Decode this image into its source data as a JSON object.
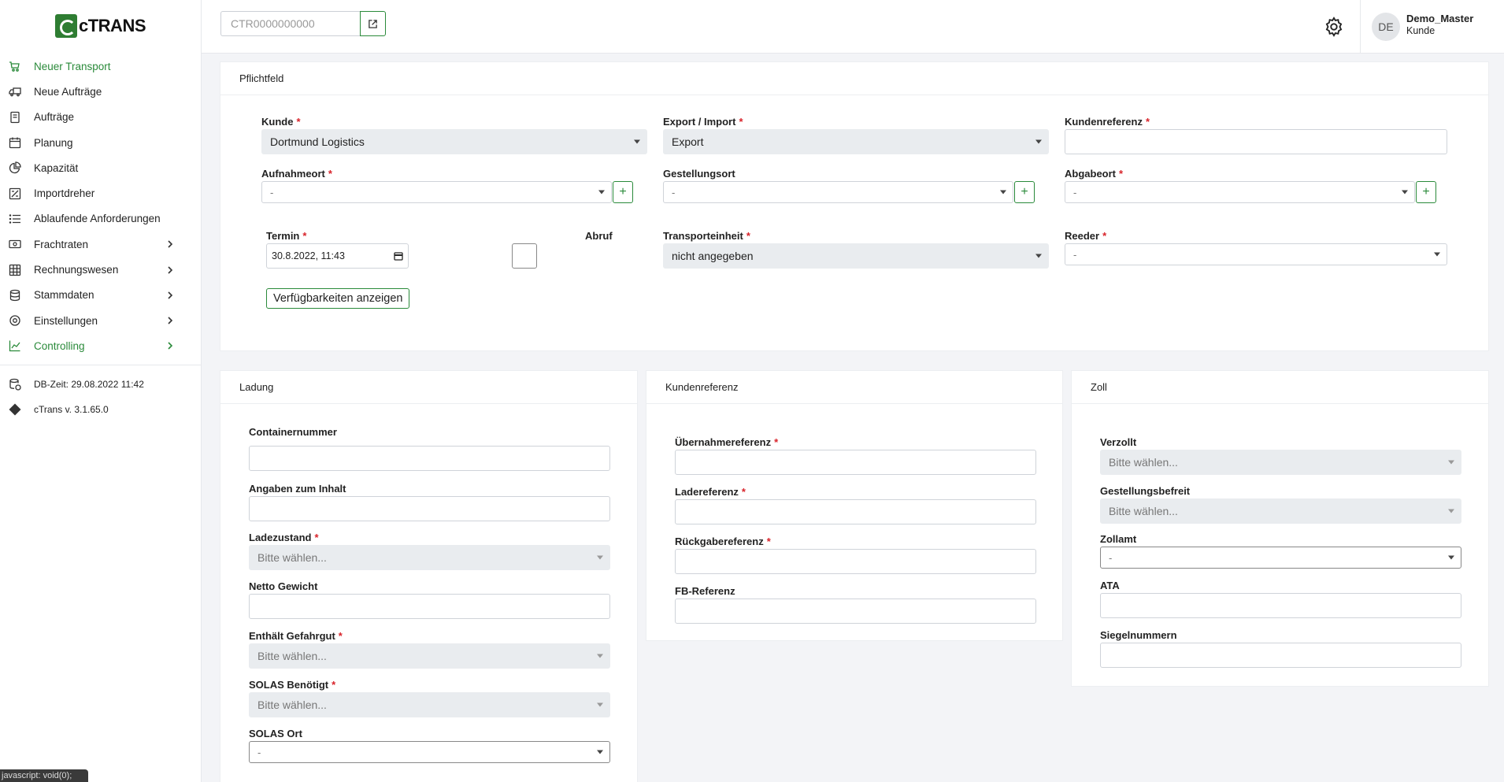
{
  "app": {
    "name": "cTRANS"
  },
  "header": {
    "search_placeholder": "CTR0000000000",
    "user_initials": "DE",
    "user_name": "Demo_Master",
    "user_role": "Kunde"
  },
  "nav": {
    "items": [
      {
        "label": "Neuer Transport",
        "icon": "truck-icon",
        "active": true
      },
      {
        "label": "Neue Aufträge",
        "icon": "truck-reverse-icon"
      },
      {
        "label": "Aufträge",
        "icon": "document-icon"
      },
      {
        "label": "Planung",
        "icon": "calendar-icon"
      },
      {
        "label": "Kapazität",
        "icon": "pie-chart-icon"
      },
      {
        "label": "Importdreher",
        "icon": "swap-icon"
      },
      {
        "label": "Ablaufende Anforderungen",
        "icon": "list-icon"
      },
      {
        "label": "Frachtraten",
        "icon": "money-icon",
        "expand": true
      },
      {
        "label": "Rechnungswesen",
        "icon": "table-icon",
        "expand": true
      },
      {
        "label": "Stammdaten",
        "icon": "database-icon",
        "expand": true
      },
      {
        "label": "Einstellungen",
        "icon": "gear-icon",
        "expand": true
      },
      {
        "label": "Controlling",
        "icon": "line-chart-icon",
        "expand": true,
        "active": true
      }
    ]
  },
  "meta": {
    "db_time": "DB-Zeit: 29.08.2022 11:42",
    "version": "cTrans v. 3.1.65.0"
  },
  "status_tooltip": "javascript: void(0);",
  "pflichtfeld": {
    "title": "Pflichtfeld",
    "kunde_label": "Kunde",
    "kunde_value": "Dortmund Logistics",
    "export_label": "Export / Import",
    "export_value": "Export",
    "kundenreferenz_label": "Kundenreferenz",
    "aufnahmeort_label": "Aufnahmeort",
    "aufnahmeort_value": "-",
    "gestellungsort_label": "Gestellungsort",
    "gestellungsort_value": "-",
    "abgabeort_label": "Abgabeort",
    "abgabeort_value": "-",
    "termin_label": "Termin",
    "termin_value": "30.8.2022, 11:43",
    "abruf_label": "Abruf",
    "transporteinheit_label": "Transporteinheit",
    "transporteinheit_value": "nicht angegeben",
    "reeder_label": "Reeder",
    "reeder_value": "-",
    "availability_button": "Verfügbarkeiten anzeigen",
    "plus": "+"
  },
  "ladung": {
    "title": "Ladung",
    "containernummer_label": "Containernummer",
    "inhalt_label": "Angaben zum Inhalt",
    "ladezustand_label": "Ladezustand",
    "ladezustand_value": "Bitte wählen...",
    "netto_label": "Netto Gewicht",
    "gefahrgut_label": "Enthält Gefahrgut",
    "gefahrgut_value": "Bitte wählen...",
    "solas_label": "SOLAS Benötigt",
    "solas_value": "Bitte wählen...",
    "solas_ort_label": "SOLAS Ort",
    "solas_ort_value": "-"
  },
  "kundenreferenz": {
    "title": "Kundenreferenz",
    "uebernahme_label": "Übernahmereferenz",
    "lade_label": "Ladereferenz",
    "rueckgabe_label": "Rückgabereferenz",
    "fb_label": "FB-Referenz"
  },
  "zoll": {
    "title": "Zoll",
    "verzollt_label": "Verzollt",
    "verzollt_value": "Bitte wählen...",
    "befreit_label": "Gestellungsbefreit",
    "befreit_value": "Bitte wählen...",
    "zollamt_label": "Zollamt",
    "zollamt_value": "-",
    "ata_label": "ATA",
    "siegel_label": "Siegelnummern"
  },
  "required_marker": "*",
  "colors": {
    "accent": "#2a8a3a",
    "required": "#d8232a"
  }
}
